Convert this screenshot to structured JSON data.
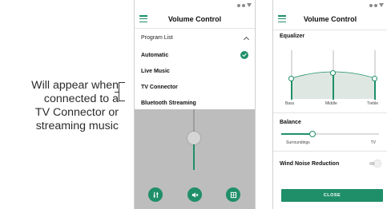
{
  "annotation": {
    "lines": [
      "Will appear when",
      "connected to a",
      "TV Connector or",
      "streaming music"
    ]
  },
  "screen1": {
    "title": "Volume Control",
    "program_list_label": "Program List",
    "programs": [
      {
        "label": "Automatic",
        "selected": true
      },
      {
        "label": "Live Music",
        "selected": false
      },
      {
        "label": "TV Connector",
        "selected": false
      },
      {
        "label": "Bluetooth Streaming",
        "selected": false
      }
    ],
    "volume_level": 0.5,
    "bottom_buttons": [
      "equalizer-icon",
      "mute-icon",
      "program-icon"
    ]
  },
  "screen2": {
    "title": "Volume Control",
    "equalizer": {
      "label": "Equalizer",
      "bands": [
        {
          "label": "Bass",
          "level": 0.45
        },
        {
          "label": "Middle",
          "level": 0.65
        },
        {
          "label": "Treble",
          "level": 0.45
        }
      ]
    },
    "balance": {
      "label": "Balance",
      "left_label": "Surroundings",
      "right_label": "TV",
      "level": 0.35
    },
    "wind_noise": {
      "label": "Wind Noise Reduction",
      "enabled": false
    },
    "close_label": "CLOSE"
  },
  "colors": {
    "accent": "#1f8f6a",
    "overlay_grey": "#bdbdbd",
    "eq_fill": "#dfe7e2"
  }
}
